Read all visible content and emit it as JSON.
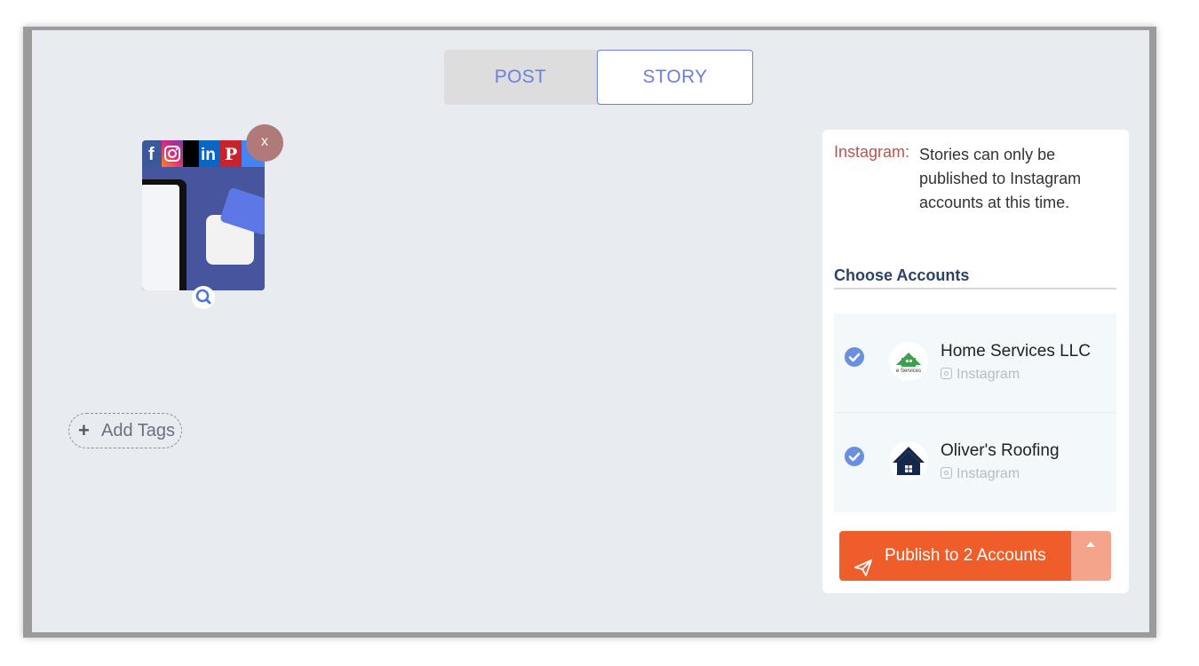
{
  "tabs": {
    "post": "POST",
    "story": "STORY",
    "active": "story"
  },
  "media": {
    "networks": [
      "facebook",
      "instagram",
      "x",
      "linkedin",
      "pinterest",
      "google-business"
    ],
    "remove_label": "x"
  },
  "tags": {
    "add_label": "Add Tags",
    "plus": "+"
  },
  "panel": {
    "notice_network": "Instagram:",
    "notice_text": "Stories can only be published to Instagram accounts at this time.",
    "choose_title": "Choose Accounts",
    "accounts": [
      {
        "name": "Home Services LLC",
        "network": "Instagram",
        "selected": true,
        "avatar_text": "e Services"
      },
      {
        "name": "Oliver's Roofing",
        "network": "Instagram",
        "selected": true
      }
    ],
    "publish_label": "Publish to 2 Accounts"
  },
  "colors": {
    "accent": "#6b7fe0",
    "publish": "#ef5e2a",
    "publish_caret": "#f4a48a",
    "notice_network": "#c0524a",
    "heading": "#2e4166"
  }
}
